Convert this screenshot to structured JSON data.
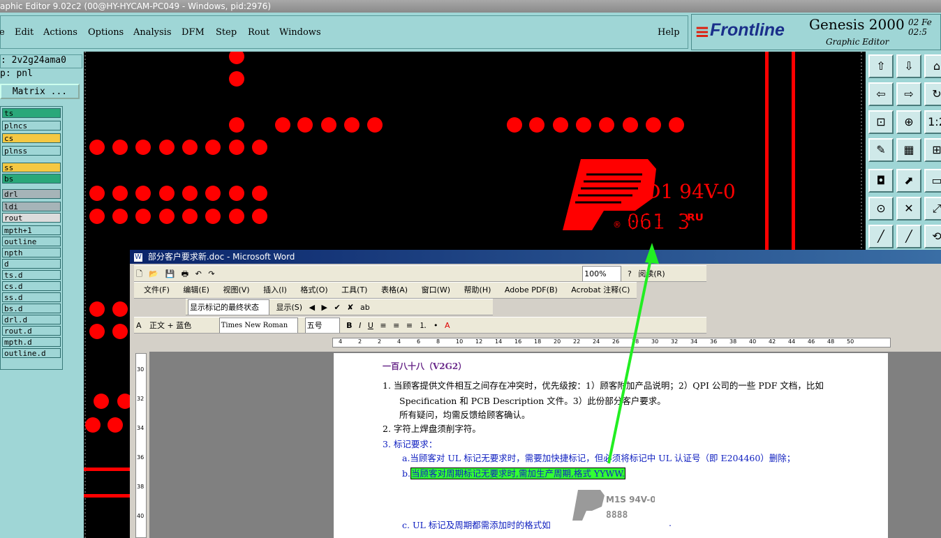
{
  "window": {
    "title": "aphic Editor 9.02c2 (00@HY-HYCAM-PC049 - Windows, pid:2976)"
  },
  "menu": {
    "items": [
      "e",
      "Edit",
      "Actions",
      "Options",
      "Analysis",
      "DFM",
      "Step",
      "Rout",
      "Windows"
    ],
    "help": "Help"
  },
  "brand": {
    "logo": "Frontline",
    "product": "Genesis 2000",
    "subtitle": "Graphic Editor",
    "date": "02 Fe",
    "time": "02:5"
  },
  "job": {
    "job_label": ": 2v2g24ama0",
    "step_label": "p: pnl",
    "matrix_button": "Matrix ..."
  },
  "layers": [
    {
      "name": "ts",
      "color": "#2aa87a"
    },
    {
      "name": "plncs",
      "color": "#9fd6d6"
    },
    {
      "name": "cs",
      "color": "#f5c842"
    },
    {
      "name": "plnss",
      "color": "#9fd6d6"
    },
    {
      "name": "ss",
      "color": "#f5c842"
    },
    {
      "name": "bs",
      "color": "#2aa87a"
    },
    {
      "name": "drl",
      "color": "#a6b4b8"
    },
    {
      "name": "ldi",
      "color": "#a6b4b8"
    },
    {
      "name": "rout",
      "color": "#dcdcdc"
    },
    {
      "name": "mpth+1",
      "color": "#9fd6d6"
    },
    {
      "name": "outline",
      "color": "#9fd6d6"
    },
    {
      "name": "npth",
      "color": "#9fd6d6"
    },
    {
      "name": "d",
      "color": "#9fd6d6"
    },
    {
      "name": "ts.d",
      "color": "#9fd6d6"
    },
    {
      "name": "cs.d",
      "color": "#9fd6d6"
    },
    {
      "name": "ss.d",
      "color": "#9fd6d6"
    },
    {
      "name": "bs.d",
      "color": "#9fd6d6"
    },
    {
      "name": "drl.d",
      "color": "#9fd6d6"
    },
    {
      "name": "rout.d",
      "color": "#9fd6d6"
    },
    {
      "name": "mpth.d",
      "color": "#9fd6d6"
    },
    {
      "name": "outline.d",
      "color": "#9fd6d6"
    }
  ],
  "canvas": {
    "marking_text": "D1  94V-0",
    "date_code": "061 3"
  },
  "word": {
    "title": "部分客户要求新.doc - Microsoft Word",
    "menus": [
      "文件(F)",
      "编辑(E)",
      "视图(V)",
      "插入(I)",
      "格式(O)",
      "工具(T)",
      "表格(A)",
      "窗口(W)",
      "帮助(H)",
      "Adobe PDF(B)",
      "Acrobat 注释(C)"
    ],
    "zoom": "100%",
    "read_button": "阅读(R)",
    "track_state": "显示标记的最终状态",
    "show_button": "显示(S)",
    "style": "正文 + 蓝色",
    "font": "Times New Roman",
    "font_size": "五号",
    "ruler_marks": [
      "4",
      "2",
      "2",
      "4",
      "6",
      "8",
      "10",
      "12",
      "14",
      "16",
      "18",
      "20",
      "22",
      "24",
      "26",
      "28",
      "30",
      "32",
      "34",
      "36",
      "38",
      "40",
      "42",
      "44",
      "46",
      "48",
      "50"
    ],
    "vruler_marks": [
      "30",
      "32",
      "34",
      "36",
      "38",
      "40"
    ],
    "doc": {
      "heading": "一百八十八（V2G2）",
      "item1": "1.   当顾客提供文件相互之间存在冲突时，优先级按：1）顾客附加产品说明；2）QPI 公司的一些 PDF 文档，比如",
      "item1b": "Specification 和 PCB    Description 文件。3）此份部分客户要求。",
      "item1c": "所有疑问，均需反馈给顾客确认。",
      "item2": "2.   字符上焊盘须削字符。",
      "item3": "3.   标记要求：",
      "item3a": "a.当顾客对 UL 标记无要求时，需要加快捷标记，但必须将标记中 UL 认证号（即 E204460）删除；",
      "item3b_prefix": "b.",
      "item3b": "当顾客对周期标记无要求时,需加生产周期,格式 YYWW.",
      "item3c": "c.  UL 标记及周期都需添加时的格式如",
      "sample_mark": "M1S 94V-0",
      "sample_code": "8888",
      "trailing_dot": "."
    }
  },
  "colors": {
    "highlight": "#33ff33",
    "arrow": "#22ee22",
    "pad": "#ff0000",
    "teal": "#9fd6d6"
  }
}
